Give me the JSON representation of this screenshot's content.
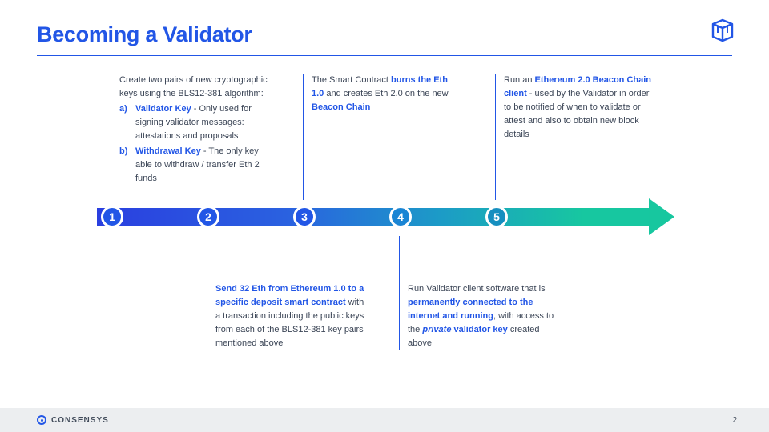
{
  "title": "Becoming a Validator",
  "brand": "CONSENSYS",
  "page_number": "2",
  "steps": {
    "s1": {
      "num": "1",
      "intro": "Create two pairs of new cryptographic keys using the BLS12-381 algorithm:",
      "a_label": "a)",
      "a_key": "Validator Key",
      "a_rest": " - Only used for signing validator messages: attestations and proposals",
      "b_label": "b)",
      "b_key": "Withdrawal Key",
      "b_rest": " - The only key able to withdraw / transfer Eth 2 funds"
    },
    "s2": {
      "num": "2",
      "hl": "Send 32 Eth from Ethereum 1.0 to a specific deposit smart contract",
      "rest": " with a transaction including the public keys from each of the BLS12-381 key pairs mentioned above"
    },
    "s3": {
      "num": "3",
      "pre": "The Smart Contract ",
      "hl1": "burns the Eth 1.0",
      "mid": " and creates Eth 2.0 on the new ",
      "hl2": "Beacon Chain"
    },
    "s4": {
      "num": "4",
      "pre": "Run Validator client software that is ",
      "hl1": "permanently connected to the internet and running",
      "mid": ", with access to the ",
      "hl2": "private",
      "mid2": " ",
      "hl3": "validator key",
      "rest": " created above"
    },
    "s5": {
      "num": "5",
      "pre": "Run an ",
      "hl": "Ethereum 2.0 Beacon Chain client",
      "rest": " - used by the Validator in order to be notified of when to validate or attest and also to obtain new block details"
    }
  }
}
